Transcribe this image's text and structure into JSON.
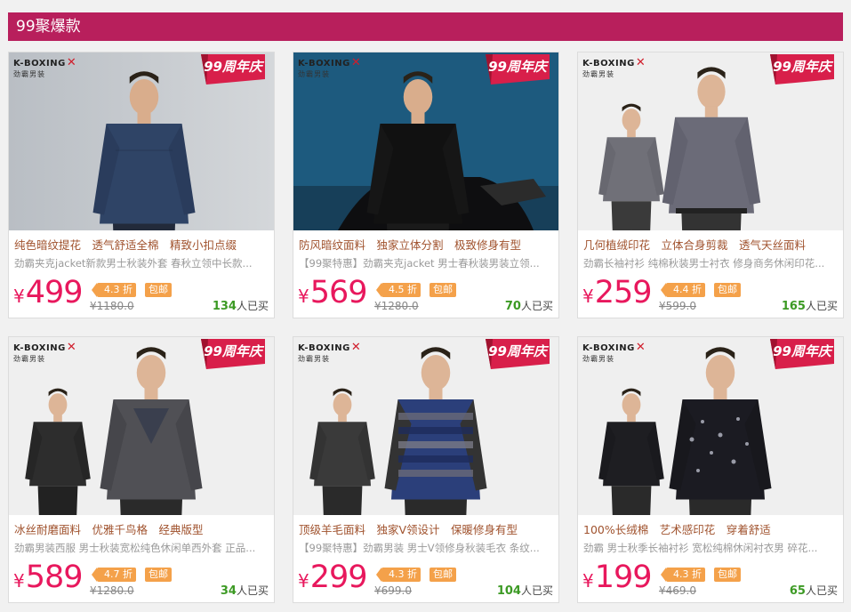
{
  "section_title": "99聚爆款",
  "colors": {
    "accent": "#b81f5c",
    "price": "#e8185d",
    "tag": "#f4a14a",
    "sold_count": "#3c9a24"
  },
  "products": [
    {
      "brand": "K-BOXING",
      "brand_sub": "劲霸男装",
      "badge": "99周年庆",
      "features": "纯色暗纹提花　透气舒适全棉　精致小扣点缀",
      "description": "劲霸夹克jacket新款男士秋装外套 春秋立领中长款...",
      "price": "499",
      "discount": "4.3 折",
      "free_ship": "包邮",
      "original_price": "¥1180.0",
      "sold_count": "134",
      "sold_suffix": "人已买",
      "photo": "navy-jacket"
    },
    {
      "brand": "K-BOXING",
      "brand_sub": "劲霸男装",
      "badge": "99周年庆",
      "features": "防风暗纹面料　独家立体分割　极致修身有型",
      "description": "【99聚特惠】劲霸夹克jacket 男士春秋装男装立领...",
      "price": "569",
      "discount": "4.5 折",
      "free_ship": "包邮",
      "original_price": "¥1280.0",
      "sold_count": "70",
      "sold_suffix": "人已买",
      "photo": "leather-jacket"
    },
    {
      "brand": "K-BOXING",
      "brand_sub": "劲霸男装",
      "badge": "99周年庆",
      "features": "几何植绒印花　立体合身剪裁　透气天丝面料",
      "description": "劲霸长袖衬衫 纯棉秋装男士衬衣 修身商务休闲印花...",
      "price": "259",
      "discount": "4.4 折",
      "free_ship": "包邮",
      "original_price": "¥599.0",
      "sold_count": "165",
      "sold_suffix": "人已买",
      "photo": "print-shirt"
    },
    {
      "brand": "K-BOXING",
      "brand_sub": "劲霸男装",
      "badge": "99周年庆",
      "features": "冰丝耐磨面料　优雅千鸟格　经典版型",
      "description": "劲霸男装西服 男士秋装宽松纯色休闲单西外套 正品...",
      "price": "589",
      "discount": "4.7 折",
      "free_ship": "包邮",
      "original_price": "¥1280.0",
      "sold_count": "34",
      "sold_suffix": "人已买",
      "photo": "blazer"
    },
    {
      "brand": "K-BOXING",
      "brand_sub": "劲霸男装",
      "badge": "99周年庆",
      "features": "顶级羊毛面料　独家V领设计　保暖修身有型",
      "description": "【99聚特惠】劲霸男装 男士V领修身秋装毛衣 条纹...",
      "price": "299",
      "discount": "4.3 折",
      "free_ship": "包邮",
      "original_price": "¥699.0",
      "sold_count": "104",
      "sold_suffix": "人已买",
      "photo": "striped-sweater"
    },
    {
      "brand": "K-BOXING",
      "brand_sub": "劲霸男装",
      "badge": "99周年庆",
      "features": "100%长绒棉　艺术感印花　穿着舒适",
      "description": "劲霸 男士秋季长袖衬衫 宽松纯棉休闲衬衣男 碎花...",
      "price": "199",
      "discount": "4.3 折",
      "free_ship": "包邮",
      "original_price": "¥469.0",
      "sold_count": "65",
      "sold_suffix": "人已买",
      "photo": "floral-shirt"
    }
  ]
}
